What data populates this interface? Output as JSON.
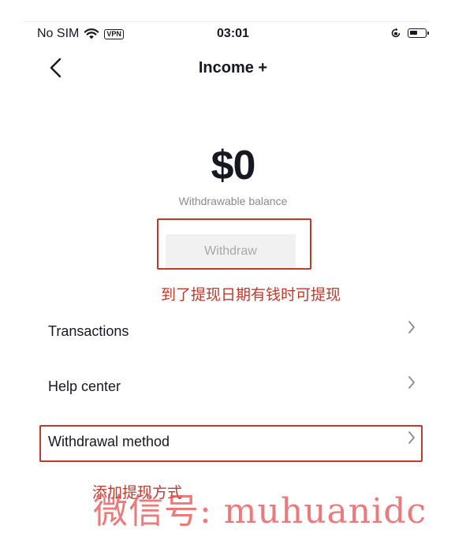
{
  "status_bar": {
    "carrier": "No SIM",
    "vpn": "VPN",
    "time": "03:01",
    "icons": [
      "wifi-icon",
      "orientation-lock-icon",
      "battery-icon"
    ]
  },
  "nav": {
    "back_icon": "chevron-left-icon",
    "title": "Income +"
  },
  "balance": {
    "amount": "$0",
    "label": "Withdrawable balance"
  },
  "withdraw_button": {
    "label": "Withdraw"
  },
  "annotations": {
    "withdraw_note": "到了提现日期有钱时可提现",
    "method_note": "添加提现方式",
    "highlight_color": "#c0392b"
  },
  "menu": {
    "items": [
      {
        "label": "Transactions",
        "icon": "chevron-right-icon"
      },
      {
        "label": "Help center",
        "icon": "chevron-right-icon"
      },
      {
        "label": "Withdrawal method",
        "icon": "chevron-right-icon"
      }
    ]
  },
  "watermark": {
    "text": "微信号: muhuanidc"
  }
}
